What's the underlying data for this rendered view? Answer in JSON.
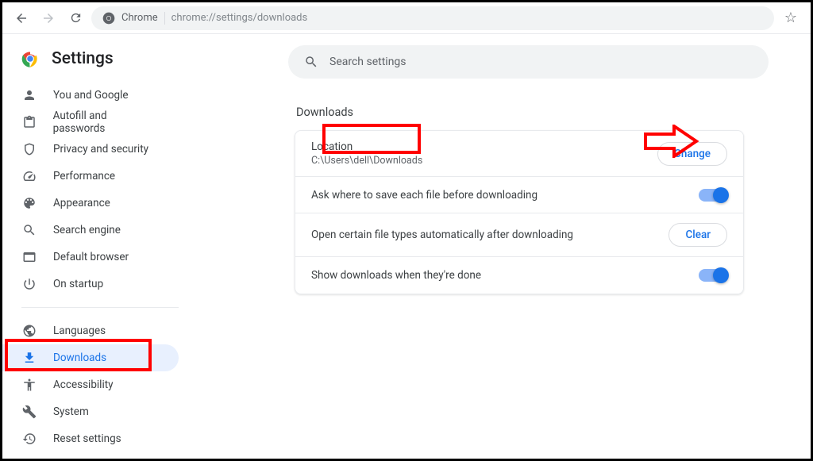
{
  "browser": {
    "label": "Chrome",
    "url": "chrome://settings/downloads"
  },
  "sidebar": {
    "title": "Settings",
    "items": [
      {
        "label": "You and Google"
      },
      {
        "label": "Autofill and passwords"
      },
      {
        "label": "Privacy and security"
      },
      {
        "label": "Performance"
      },
      {
        "label": "Appearance"
      },
      {
        "label": "Search engine"
      },
      {
        "label": "Default browser"
      },
      {
        "label": "On startup"
      },
      {
        "label": "Languages"
      },
      {
        "label": "Downloads"
      },
      {
        "label": "Accessibility"
      },
      {
        "label": "System"
      },
      {
        "label": "Reset settings"
      }
    ]
  },
  "search": {
    "placeholder": "Search settings"
  },
  "section": {
    "title": "Downloads"
  },
  "rows": {
    "location_label": "Location",
    "location_value": "C:\\Users\\dell\\Downloads",
    "change_btn": "Change",
    "ask_label": "Ask where to save each file before downloading",
    "open_label": "Open certain file types automatically after downloading",
    "clear_btn": "Clear",
    "show_label": "Show downloads when they're done"
  }
}
